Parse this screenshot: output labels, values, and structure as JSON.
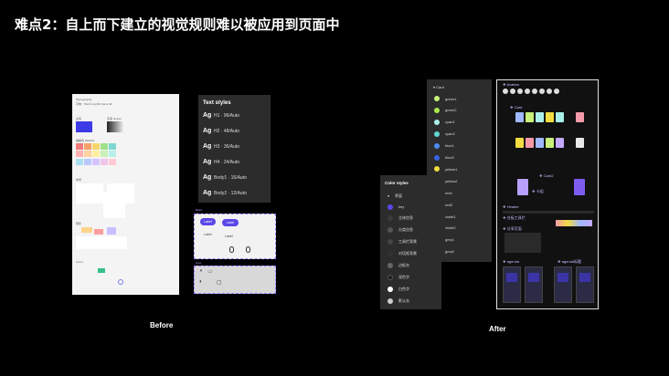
{
  "title": "难点2：自上而下建立的视觉规则难以被应用到页面中",
  "before": {
    "caption": "Before",
    "sheet": {
      "heading": "Typography",
      "subheading": "字体：HarmonyOS Sans SC",
      "section_primary": "主色",
      "section_gray": "灰度 Grays",
      "section_palette": "辅助色 Palette",
      "section_layout": "布局",
      "section_shadow": "阴影",
      "section_icons": "Icons"
    },
    "text_styles": {
      "title": "Text styles",
      "glyph": "Ag",
      "items": [
        "H1 · 96/Auto",
        "H2 · 48/Auto",
        "H3 · 36/Auto",
        "H4 · 24/Auto",
        "Body1 · 16/Auto",
        "Body2 · 12/Auto"
      ]
    },
    "button_sheet": {
      "frame_label": "Button",
      "pill1": "Label",
      "pill2": "Label",
      "label1": "Label",
      "label2": "Label"
    },
    "icon_sheet": {
      "frame_label": "Icons"
    }
  },
  "after": {
    "caption": "After",
    "color_panel": {
      "header": "Card",
      "items": [
        {
          "name": "green1",
          "color": "#c9f27a"
        },
        {
          "name": "green2",
          "color": "#a8e84d"
        },
        {
          "name": "cyan1",
          "color": "#a9f0ea"
        },
        {
          "name": "cyan2",
          "color": "#5fd8d0"
        },
        {
          "name": "blue1",
          "color": "#4e8cf5"
        },
        {
          "name": "blue2",
          "color": "#3a63e6"
        },
        {
          "name": "yellow1",
          "color": "#f2dc42"
        },
        {
          "name": "yellow2",
          "color": "#e6c229"
        },
        {
          "name": "red1",
          "color": "#f25b52"
        },
        {
          "name": "red2",
          "color": "#e0433b"
        },
        {
          "name": "violet1",
          "color": "#7e5cf0"
        },
        {
          "name": "violet2",
          "color": "#5a3ed6"
        },
        {
          "name": "grey1",
          "color": "#aaaaaa"
        },
        {
          "name": "grey2",
          "color": "#7a7a7a"
        }
      ]
    },
    "color_styles": {
      "title": "Color styles",
      "group": "界面",
      "items": [
        {
          "name": "key",
          "color": "#5a47e8"
        },
        {
          "name": "主体信息",
          "color": "#3a3a3a"
        },
        {
          "name": "分类信息",
          "color": "#555555"
        },
        {
          "name": "工具栏背景",
          "color": "#444444"
        },
        {
          "name": "对话框背景",
          "color": "#333333"
        },
        {
          "name": "边框灰",
          "color": "#666666"
        },
        {
          "name": "深色字",
          "color": "#1e1e1e"
        },
        {
          "name": "白色字",
          "color": "#ffffff"
        },
        {
          "name": "默认灰",
          "color": "#cccccc"
        }
      ]
    },
    "board": {
      "avatars": "Avatars",
      "card": "Card",
      "card2": "Card2",
      "tab": "卡组",
      "header": "Header",
      "toolbar": "台板工具栏",
      "section": "分享页面",
      "agenda1": "agenda",
      "agenda2": "agenda标题"
    }
  }
}
